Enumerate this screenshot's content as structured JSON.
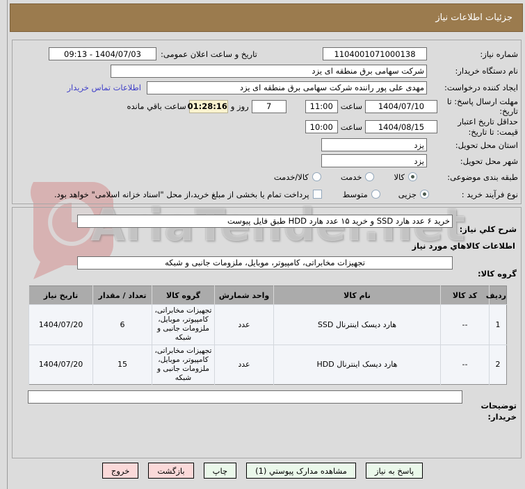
{
  "title": "جزئیات اطلاعات نیاز",
  "watermark_text": "AriaTender.net",
  "colors": {
    "titlebar": "#9b7b4e",
    "countdown_bg": "#faf3cf",
    "button_green": "#eaf8ea",
    "button_pink": "#fbd9d9",
    "table_header_bg": "#ababab",
    "table_row_bg": "#f3f5f9",
    "link": "#4040c8"
  },
  "form": {
    "need_number": {
      "label": "شماره نیاز:",
      "value": "1104001071000138"
    },
    "announce": {
      "label": "تاریخ و ساعت اعلان عمومی:",
      "value": "1404/07/03 - 09:13"
    },
    "buyer_org": {
      "label": "نام دستگاه خریدار:",
      "value": "شرکت سهامی برق منطقه ای یزد"
    },
    "creator": {
      "label": "ایجاد کننده درخواست:",
      "value": "مهدی علی پور راننده شرکت سهامی برق منطقه ای یزد",
      "contact_link": "اطلاعات تماس خریدار"
    },
    "deadline": {
      "label": "مهلت ارسال پاسخ: تا تاریخ:",
      "date": "1404/07/10",
      "hour_label": "ساعت",
      "time": "11:00",
      "days": "7",
      "days_label": "روز و",
      "countdown": "01:28:16",
      "remaining_label": "ساعت باقي مانده"
    },
    "validity": {
      "label": "حداقل تاریخ اعتبار قیمت: تا تاریخ:",
      "date": "1404/08/15",
      "hour_label": "ساعت",
      "time": "10:00"
    },
    "province": {
      "label": "استان محل تحویل:",
      "value": "یزد"
    },
    "city": {
      "label": "شهر محل تحویل:",
      "value": "یزد"
    },
    "classification": {
      "label": "طبقه بندی موضوعی:",
      "options": [
        {
          "label": "کالا",
          "selected": true
        },
        {
          "label": "خدمت",
          "selected": false
        },
        {
          "label": "کالا/خدمت",
          "selected": false
        }
      ]
    },
    "process": {
      "label": "نوع فرآیند خرید :",
      "options": [
        {
          "label": "جزیی",
          "selected": true
        },
        {
          "label": "متوسط",
          "selected": false
        }
      ],
      "checkbox_label": "پرداخت تمام یا بخشی از مبلغ خرید،از محل \"اسناد خزانه اسلامی\" خواهد بود.",
      "checkbox_checked": false
    }
  },
  "need_desc": {
    "label": "شرح کلي نیاز:",
    "value": "خرید ۶ عدد هارد SSD و خرید ۱۵ عدد هارد HDD طبق فایل پیوست"
  },
  "goods_section": {
    "header": "اطلاعات کالاهاي مورد نیاز",
    "group_label": "گروه کالا:",
    "group_value": "تجهیزات مخابراتی، کامپیوتر، موبایل، ملزومات جانبی و شبکه"
  },
  "table": {
    "headers": [
      "ردیف",
      "کد کالا",
      "نام کالا",
      "واحد شمارش",
      "گروه کالا",
      "تعداد / مقدار",
      "تاریخ نیاز"
    ],
    "rows": [
      [
        "1",
        "--",
        "هارد دیسک اینترنال SSD",
        "عدد",
        "تجهیزات مخابراتی، کامپیوتر، موبایل، ملزومات جانبی و شبکه",
        "6",
        "1404/07/20"
      ],
      [
        "2",
        "--",
        "هارد دیسک اینترنال HDD",
        "عدد",
        "تجهیزات مخابراتی، کامپیوتر، موبایل، ملزومات جانبی و شبکه",
        "15",
        "1404/07/20"
      ]
    ]
  },
  "notes": {
    "label": "توضیحات خریدار:",
    "value": ""
  },
  "buttons": {
    "reply": "پاسخ به نیاز",
    "view_docs": "مشاهده مدارک پیوستي (1)",
    "print": "چاپ",
    "back": "بازگشت",
    "exit": "خروج"
  }
}
